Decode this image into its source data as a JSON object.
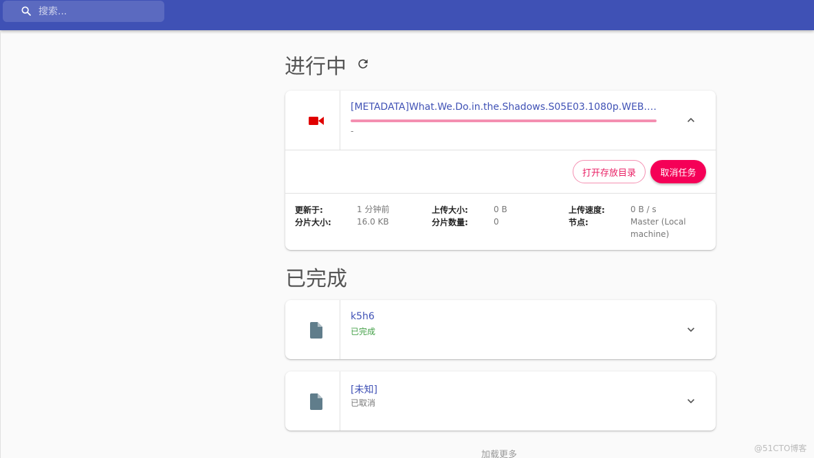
{
  "search": {
    "placeholder": "搜索..."
  },
  "sections": {
    "in_progress_title": "进行中",
    "completed_title": "已完成"
  },
  "active_task": {
    "title": "[METADATA]What.We.Do.in.the.Shadows.S05E03.1080p.WEB.h2…",
    "progress": 1.0,
    "status": "-",
    "buttons": {
      "open_folder": "打开存放目录",
      "cancel": "取消任务"
    },
    "details": {
      "updated_label": "更新于:",
      "updated_value": "1 分钟前",
      "chunk_size_label": "分片大小:",
      "chunk_size_value": "16.0 KB",
      "upload_size_label": "上传大小:",
      "upload_size_value": "0 B",
      "chunk_count_label": "分片数量:",
      "chunk_count_value": "0",
      "upload_speed_label": "上传速度:",
      "upload_speed_value": "0 B / s",
      "node_label": "节点:",
      "node_value_line1": "Master (Local",
      "node_value_line2": "machine)"
    }
  },
  "completed_tasks": [
    {
      "title": "k5h6",
      "status": "已完成",
      "status_color": "#43a047"
    },
    {
      "title": "[未知]",
      "status": "已取消",
      "status_color": "#777777"
    }
  ],
  "load_more": "加载更多",
  "watermark": "@51CTO博客",
  "colors": {
    "appbar": "#3f51b5",
    "accent": "#f50057",
    "video_icon": "#e00000",
    "file_icon": "#607d8b"
  }
}
